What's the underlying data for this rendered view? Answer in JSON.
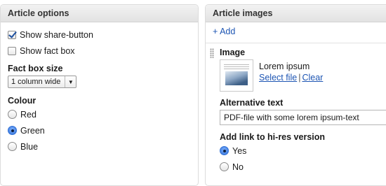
{
  "article_options": {
    "title": "Article options",
    "show_share_button": {
      "label": "Show share-button",
      "checked": true
    },
    "show_fact_box": {
      "label": "Show fact box",
      "checked": false
    },
    "fact_box_size": {
      "label": "Fact box size",
      "selected": "1 column wide"
    },
    "colour": {
      "label": "Colour",
      "options": [
        {
          "label": "Red",
          "selected": false
        },
        {
          "label": "Green",
          "selected": true
        },
        {
          "label": "Blue",
          "selected": false
        }
      ]
    }
  },
  "article_images": {
    "title": "Article images",
    "add_link": "+ Add",
    "image": {
      "label": "Image",
      "caption": "Lorem ipsum",
      "select_file": "Select file",
      "separator": "|",
      "clear": "Clear",
      "alt_text": {
        "label": "Alternative text",
        "value": "PDF-file with some lorem ipsum-text"
      },
      "hi_res": {
        "label": "Add link to hi-res version",
        "options": [
          {
            "label": "Yes",
            "selected": true
          },
          {
            "label": "No",
            "selected": false
          }
        ]
      }
    }
  }
}
